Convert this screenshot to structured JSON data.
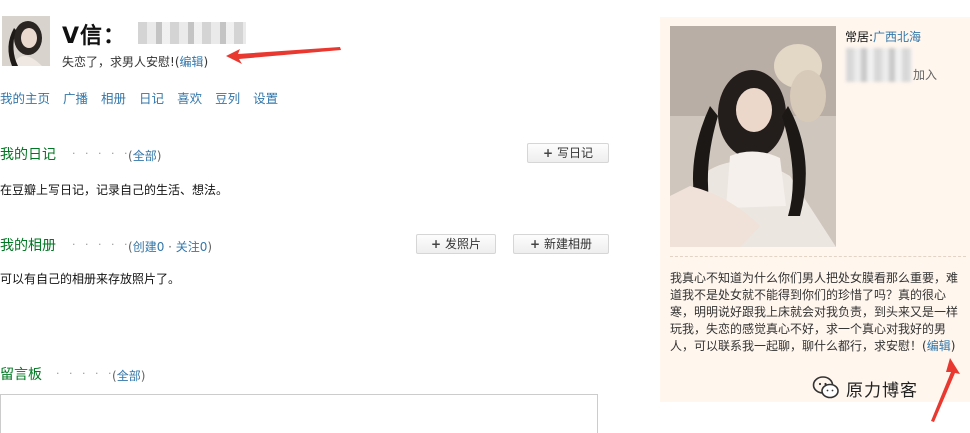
{
  "header": {
    "name": "V信：",
    "signature": "失恋了，求男人安慰!",
    "edit_open": "(",
    "edit_label": "编辑",
    "edit_close": ")"
  },
  "nav": {
    "items": [
      "我的主页",
      "广播",
      "相册",
      "日记",
      "喜欢",
      "豆列",
      "设置"
    ]
  },
  "diary": {
    "title": "我的日记",
    "dots": "· · · · · ·",
    "link_open": "(",
    "link_all": "全部",
    "link_close": ")",
    "write_button": "写日记",
    "desc": "在豆瓣上写日记，记录自己的生活、想法。"
  },
  "album": {
    "title": "我的相册",
    "dots": "· · · · · ·",
    "link_open": "(",
    "link_create": "创建0",
    "link_sep": " · ",
    "link_follow": "关注0",
    "link_close": ")",
    "upload_button": "发照片",
    "new_button": "新建相册",
    "desc": "可以有自己的相册来存放照片了。"
  },
  "guestbook": {
    "title": "留言板",
    "dots": "· · · · · ·",
    "link_open": "(",
    "link_all": "全部",
    "link_close": ")"
  },
  "profile": {
    "location_label": "常居:",
    "location_value": "广西北海",
    "joined": "加入",
    "intro_text": "我真心不知道为什么你们男人把处女膜看那么重要，难道我不是处女就不能得到你们的珍惜了吗？真的很心寒，明明说好跟我上床就会对我负责，到头来又是一样玩我，失恋的感觉真心不好，求一个真心对我好的男人，可以联系我一起聊，聊什么都行，求安慰！",
    "edit_open": "(",
    "edit_label": "编辑",
    "edit_close": ")"
  },
  "watermark": {
    "text": "原力博客"
  },
  "colors": {
    "link": "#3377aa",
    "section_title": "#007722",
    "panel_bg": "#fff6ee",
    "arrow": "#e8382f"
  },
  "icons": {
    "plus": "plus-icon",
    "arrow": "red-arrow-annotation",
    "watermark": "wechat-logo-icon"
  }
}
